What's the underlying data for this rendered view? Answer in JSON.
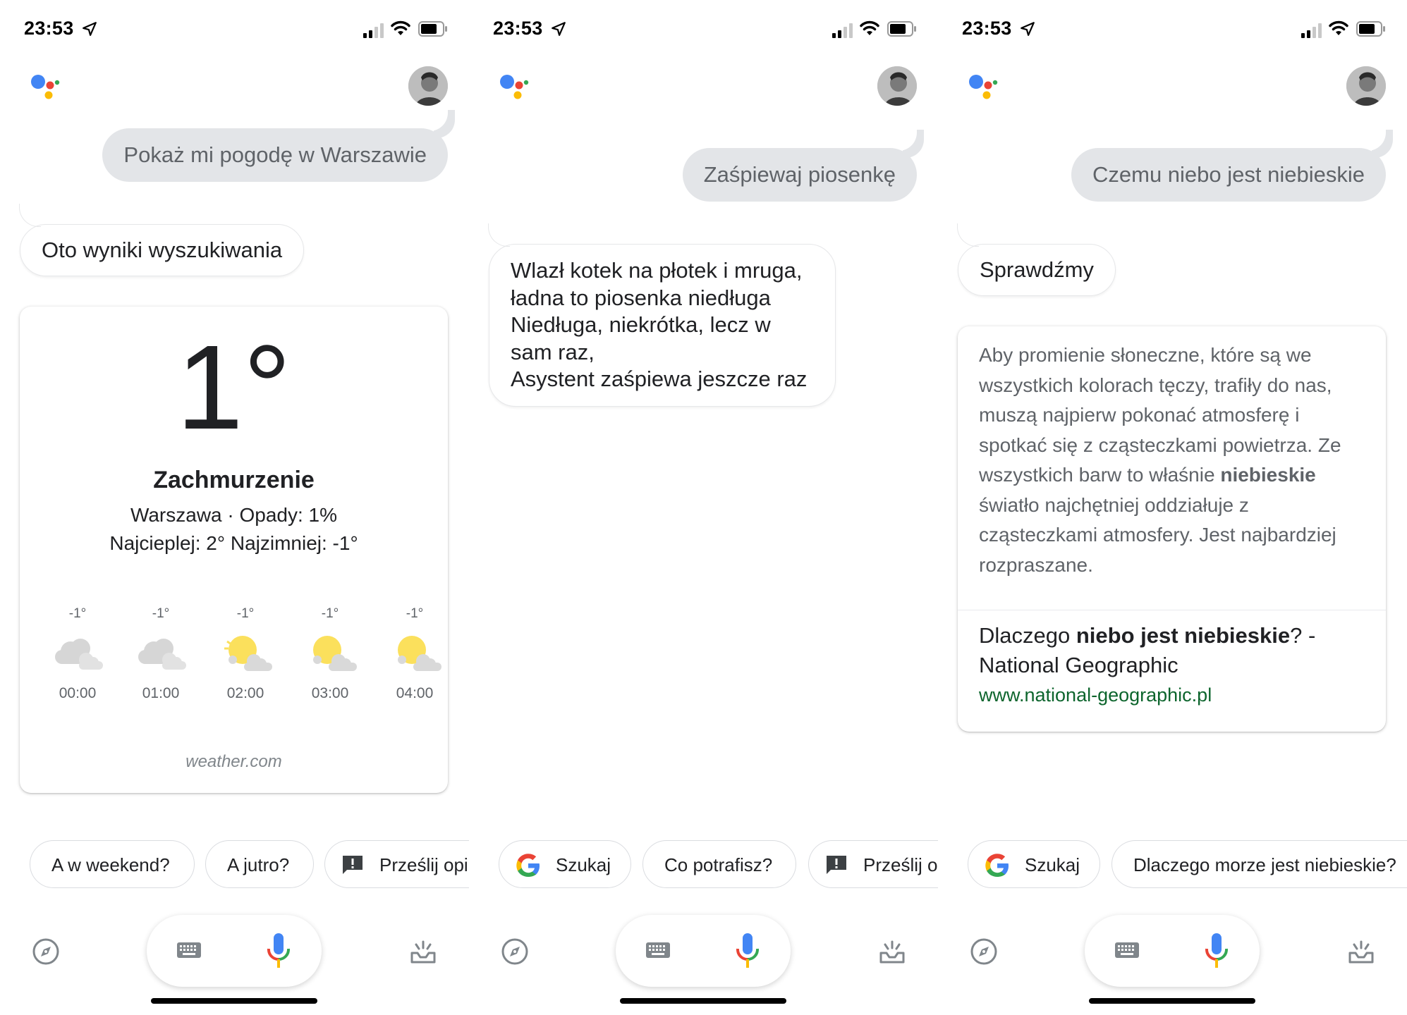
{
  "screens": [
    {
      "time": "23:53",
      "user_query": "Pokaż mi pogodę w Warszawie",
      "response": "Oto wyniki wyszukiwania",
      "weather": {
        "temperature": "1°",
        "condition": "Zachmurzenie",
        "location_precip": "Warszawa · Opady: 1%",
        "high_low": "Najcieplej: 2° Najzimniej: -1°",
        "hours": [
          {
            "temp": "-1°",
            "time": "00:00",
            "icon": "cloudy-icon"
          },
          {
            "temp": "-1°",
            "time": "01:00",
            "icon": "cloudy-icon"
          },
          {
            "temp": "-1°",
            "time": "02:00",
            "icon": "partly-sunny-icon"
          },
          {
            "temp": "-1°",
            "time": "03:00",
            "icon": "partly-sunny-icon"
          },
          {
            "temp": "-1°",
            "time": "04:00",
            "icon": "partly-sunny-icon"
          }
        ],
        "source": "weather.com"
      },
      "chips": [
        "A w weekend?",
        "A jutro?",
        "Prześlij opi"
      ]
    },
    {
      "time": "23:53",
      "user_query": "Zaśpiewaj piosenkę",
      "response_lines": [
        "Wlazł kotek na płotek i mruga,",
        "ładna to piosenka niedługa",
        "Niedługa, niekrótka, lecz w",
        "sam raz,",
        "Asystent zaśpiewa jeszcze raz"
      ],
      "chips": [
        "Szukaj",
        "Co potrafisz?",
        "Prześlij o"
      ]
    },
    {
      "time": "23:53",
      "user_query": "Czemu niebo jest niebieskie",
      "response": "Sprawdźmy",
      "info": {
        "text_before": "Aby promienie słoneczne, które są we wszystkich kolorach tęczy, trafiły do nas, muszą najpierw pokonać atmosferę i spotkać się z cząsteczkami powietrza. Ze wszystkich barw to właśnie",
        "text_bold": "niebieskie",
        "text_after": "światło najchętniej oddziałuje z cząsteczkami atmosfery. Jest najbardziej rozpraszane.",
        "title_before": "Dlaczego",
        "title_bold": "niebo jest niebieskie",
        "title_after": "? - National Geographic",
        "url": "www.national-geographic.pl"
      },
      "chips": [
        "Szukaj",
        "Dlaczego morze jest niebieskie?"
      ]
    }
  ],
  "colors": {
    "google_blue": "#4285F4",
    "google_red": "#EA4335",
    "google_yellow": "#FBBC05",
    "google_green": "#34A853",
    "user_bubble": "#e3e5e8",
    "link_green": "#0d652d"
  },
  "icons": {
    "status": [
      "location-arrow-icon",
      "signal-icon",
      "wifi-icon",
      "battery-icon"
    ],
    "bottom": [
      "explore-compass-icon",
      "keyboard-icon",
      "microphone-icon",
      "updates-tray-icon"
    ],
    "chips": [
      "google-g-icon",
      "feedback-icon"
    ]
  }
}
